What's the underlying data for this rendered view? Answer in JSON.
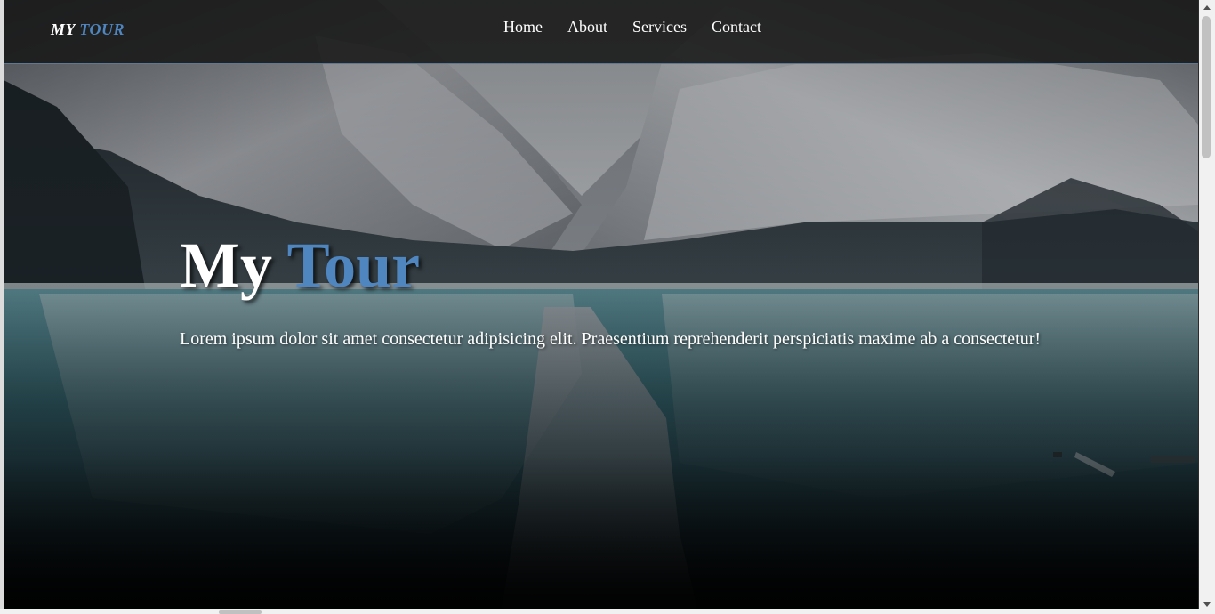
{
  "navbar": {
    "brand_main": "MY",
    "brand_accent": "TOUR",
    "links": [
      "Home",
      "About",
      "Services",
      "Contact"
    ]
  },
  "hero": {
    "title_main": "My",
    "title_accent": "Tour",
    "text": "Lorem ipsum dolor sit amet consectetur adipisicing elit. Praesentium reprehenderit perspiciatis maxime ab a consectetur!",
    "background": "mountain-lake-icon"
  },
  "colors": {
    "accent": "#4f86c0",
    "navbar_bg": "#181818",
    "navbar_border": "#5d7894",
    "text": "#ffffff"
  }
}
